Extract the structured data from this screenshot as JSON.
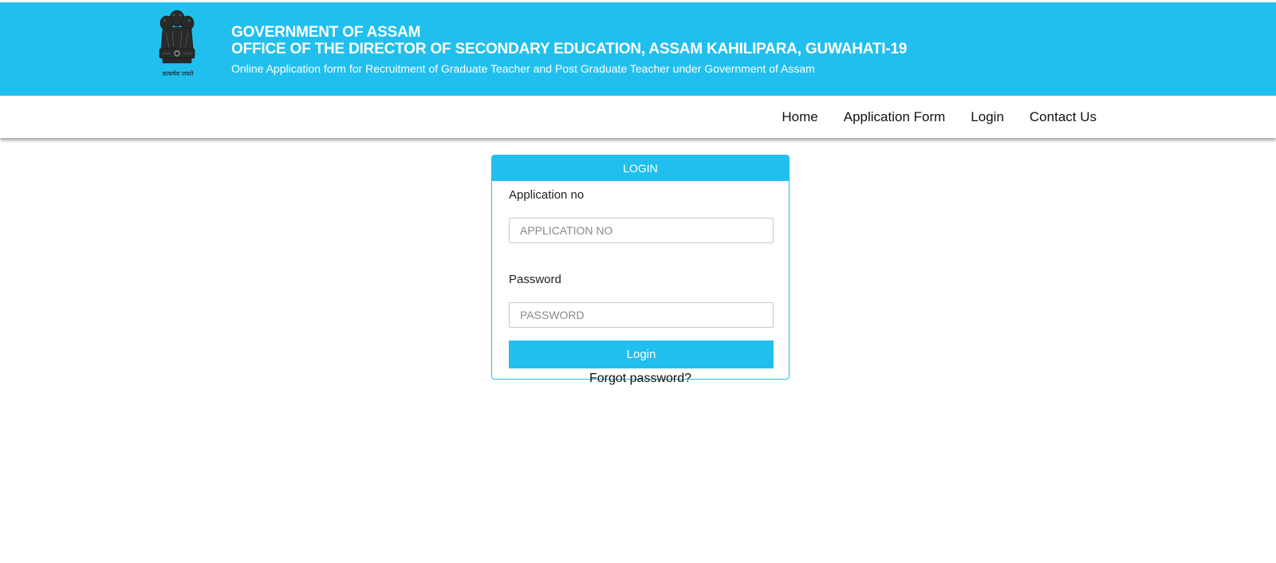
{
  "header": {
    "title_line1": "GOVERNMENT OF ASSAM",
    "title_line2": "OFFICE OF THE DIRECTOR OF SECONDARY EDUCATION, ASSAM KAHILIPARA, GUWAHATI-19",
    "subtitle": "Online Application form for Recruitment of Graduate Teacher and Post Graduate Teacher under Government of Assam",
    "emblem_motto": "सत्यमेव जयते",
    "emblem_icon": "national-emblem-icon",
    "background_color": "#21bfee"
  },
  "nav": {
    "items": [
      "Home",
      "Application Form",
      "Login",
      "Contact Us"
    ]
  },
  "login_card": {
    "header": "LOGIN",
    "application_label": "Application no",
    "application_placeholder": "APPLICATION NO",
    "password_label": "Password",
    "password_placeholder": "PASSWORD",
    "button_label": "Login",
    "forgot_password": "Forgot password?",
    "accent_color": "#21bfee"
  }
}
